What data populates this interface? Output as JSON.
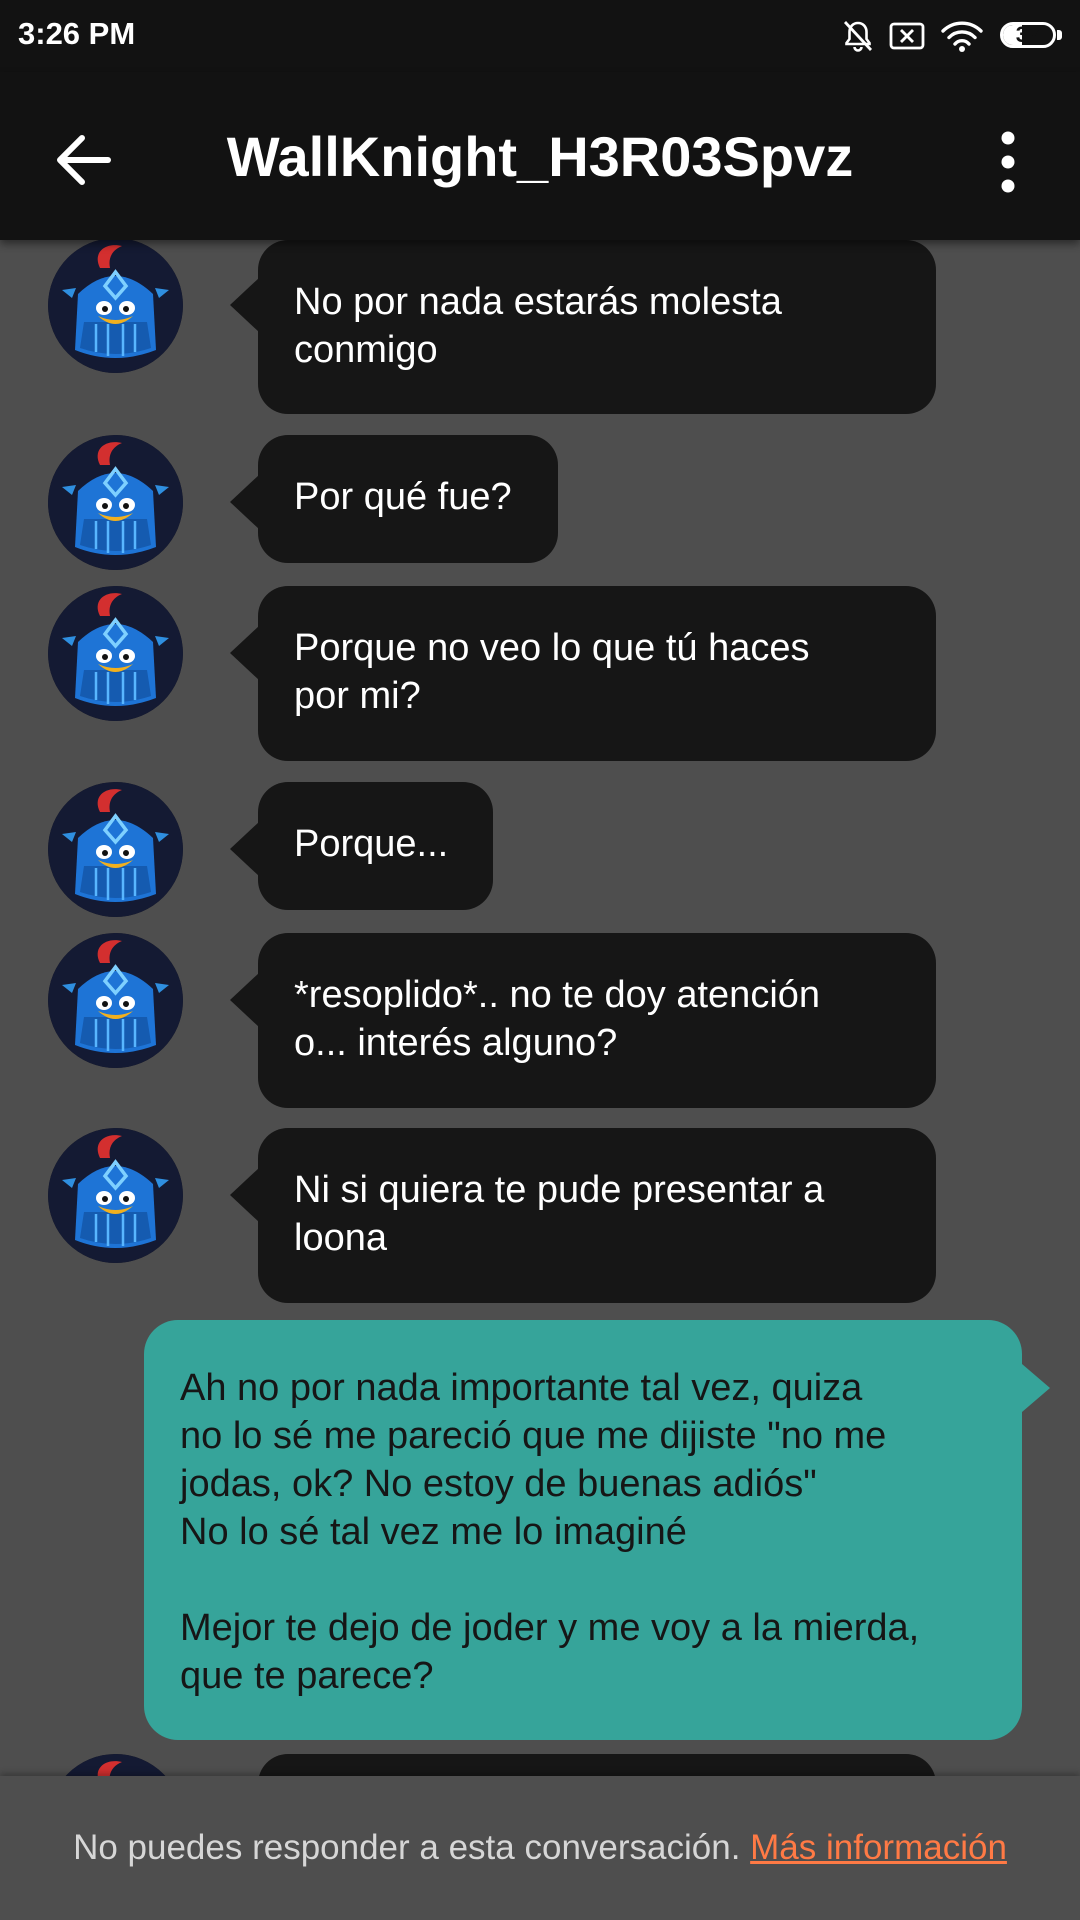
{
  "status_bar": {
    "time": "3:26 PM",
    "battery_level": "37",
    "battery_fraction": 0.37,
    "icons": [
      "bell-off-icon",
      "sim-missing-icon",
      "wifi-icon",
      "battery-icon"
    ]
  },
  "app_bar": {
    "title": "WallKnight_H3R03Spvz",
    "back_icon": "arrow-left-icon",
    "menu_icon": "more-vertical-icon"
  },
  "messages": [
    {
      "from": "them",
      "text": "No por nada estarás molesta\nconmigo"
    },
    {
      "from": "them",
      "text": "Por qué fue?"
    },
    {
      "from": "them",
      "text": "Porque no veo lo que tú haces\npor mi?"
    },
    {
      "from": "them",
      "text": "Porque..."
    },
    {
      "from": "them",
      "text": "*resoplido*.. no te doy atención\no... interés alguno?"
    },
    {
      "from": "them",
      "text": "Ni si quiera te pude presentar a\nloona"
    },
    {
      "from": "me",
      "text": "Ah no por nada importante tal vez, quiza\nno lo sé me pareció que me dijiste \"no me\njodas, ok? No estoy de buenas adiós\"\nNo lo sé tal vez me lo imaginé\n\nMejor te dejo de joder y me voy a la mierda,\nque te parece?"
    }
  ],
  "footer": {
    "notice": "No puedes responder a esta conversación.",
    "link": "Más información"
  },
  "colors": {
    "background": "#4e4e4e",
    "bar": "#121212",
    "incoming_bubble": "#161616",
    "outgoing_bubble": "#36a49a",
    "link": "#ff7a45"
  }
}
